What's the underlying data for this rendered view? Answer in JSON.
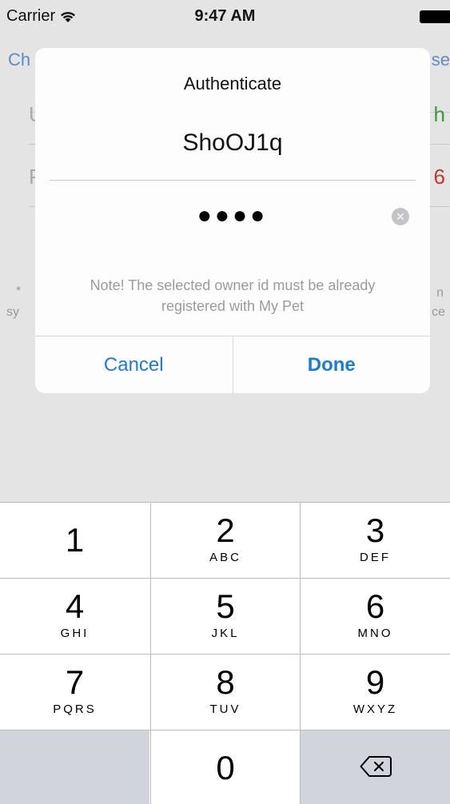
{
  "status_bar": {
    "carrier": "Carrier",
    "time": "9:47 AM"
  },
  "background_screen": {
    "nav_left": "Ch",
    "nav_right": "se",
    "row1_left": "U",
    "row1_right": "h",
    "row2_left": "P",
    "row2_right": "6",
    "note_left_1": "*",
    "note_left_2": "sy",
    "note_right_1": "n",
    "note_right_2": "ce",
    "accent_green": "#3c9a3c",
    "accent_red": "#c0392b"
  },
  "alert": {
    "title": "Authenticate",
    "owner_id": "ShoOJ1q",
    "password_value": "●●●●",
    "clear_glyph": "✕",
    "note": "Note! The selected owner id must be already registered with My Pet",
    "cancel_label": "Cancel",
    "done_label": "Done",
    "button_color": "#1a7bd8"
  },
  "keypad": {
    "keys": [
      {
        "digit": "1",
        "letters": ""
      },
      {
        "digit": "2",
        "letters": "ABC"
      },
      {
        "digit": "3",
        "letters": "DEF"
      },
      {
        "digit": "4",
        "letters": "GHI"
      },
      {
        "digit": "5",
        "letters": "JKL"
      },
      {
        "digit": "6",
        "letters": "MNO"
      },
      {
        "digit": "7",
        "letters": "PQRS"
      },
      {
        "digit": "8",
        "letters": "TUV"
      },
      {
        "digit": "9",
        "letters": "WXYZ"
      },
      {
        "digit": "0",
        "letters": ""
      }
    ],
    "delete_icon": "backspace-icon"
  }
}
